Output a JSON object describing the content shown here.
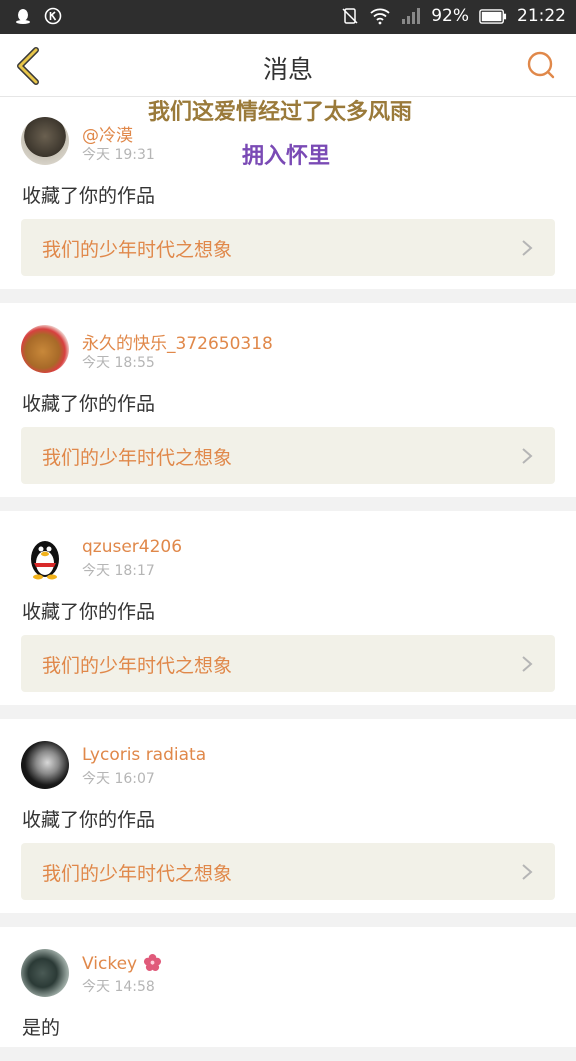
{
  "status_bar": {
    "battery": "92%",
    "time": "21:22"
  },
  "header": {
    "title": "消息"
  },
  "overlay": {
    "line1": "我们这爱情经过了太多风雨",
    "line2": "拥入怀里"
  },
  "messages": [
    {
      "username": "@冷漠",
      "time": "今天 19:31",
      "action": "收藏了你的作品",
      "work_title": "我们的少年时代之想象"
    },
    {
      "username": "永久的快乐_372650318",
      "time": "今天 18:55",
      "action": "收藏了你的作品",
      "work_title": "我们的少年时代之想象"
    },
    {
      "username": "qzuser4206",
      "time": "今天 18:17",
      "action": "收藏了你的作品",
      "work_title": "我们的少年时代之想象"
    },
    {
      "username": "Lycoris radiata",
      "time": "今天 16:07",
      "action": "收藏了你的作品",
      "work_title": "我们的少年时代之想象"
    },
    {
      "username": "Vickey",
      "time": "今天 14:58",
      "action": "是的",
      "work_title": ""
    }
  ],
  "colors": {
    "accent": "#e0884a",
    "status_bar": "#2e2e2e",
    "work_bg": "#f2f1e8"
  }
}
